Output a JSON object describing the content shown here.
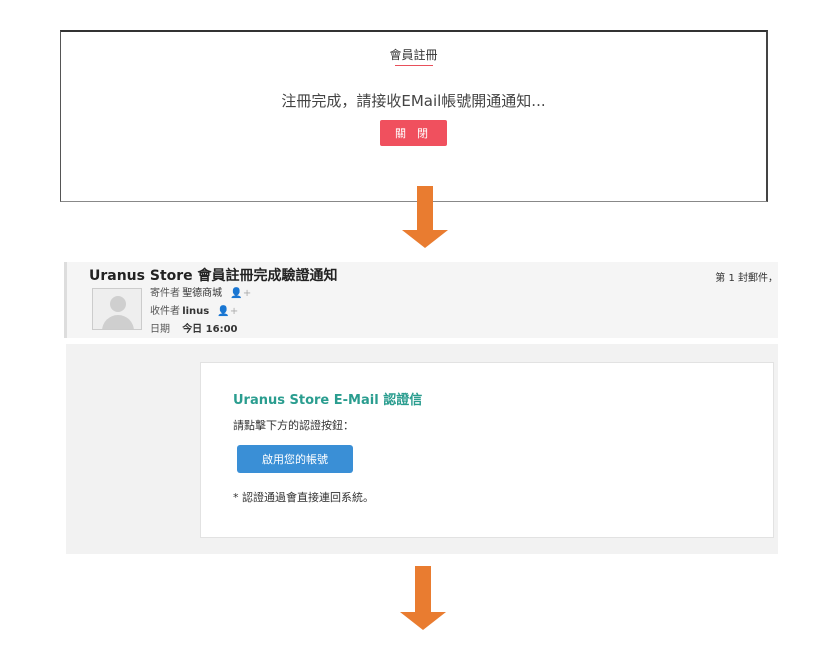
{
  "modal": {
    "title": "會員註冊",
    "message": "注冊完成，請接收EMail帳號開通通知...",
    "close_label": "關 閉"
  },
  "mail": {
    "subject": "Uranus Store 會員註冊完成驗證通知",
    "count": "第 1 封郵件，",
    "sender_label": "寄件者",
    "sender": "聖德商城",
    "recipient_label": "收件者",
    "recipient": "linus",
    "date_label": "日期",
    "date": "今日 16:00",
    "add_contact_glyph": "👤+"
  },
  "card": {
    "title": "Uranus Store E-Mail 認證信",
    "instruction": "請點擊下方的認證按鈕：",
    "button_label": "啟用您的帳號",
    "note": "* 認證通過會直接連回系統。"
  },
  "colors": {
    "arrow": "#e97c30",
    "close_button": "#f0505e",
    "activate_button": "#3a8fd6",
    "card_title": "#2a9d8f"
  },
  "icons": [
    "arrow-down-icon",
    "avatar-icon",
    "add-contact-icon"
  ]
}
